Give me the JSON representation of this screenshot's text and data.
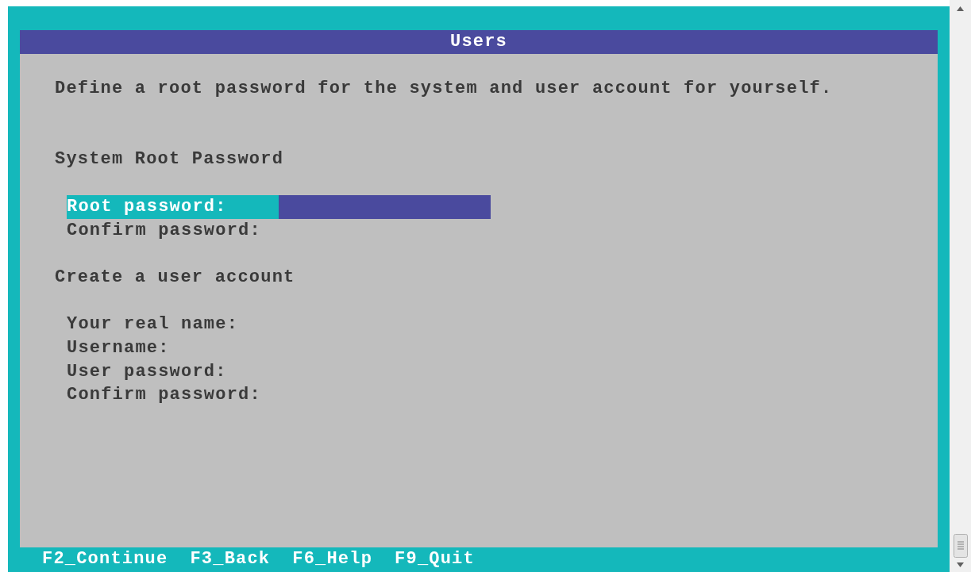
{
  "dialog": {
    "title": "Users",
    "description": "Define a root password for the system and user account for yourself.",
    "sections": [
      {
        "heading": "System Root Password",
        "fields": [
          {
            "label": "Root password:",
            "focused": true
          },
          {
            "label": "Confirm password:",
            "focused": false
          }
        ]
      },
      {
        "heading": "Create a user account",
        "fields": [
          {
            "label": "Your real name:",
            "focused": false
          },
          {
            "label": "Username:",
            "focused": false
          },
          {
            "label": "User password:",
            "focused": false
          },
          {
            "label": "Confirm password:",
            "focused": false
          }
        ]
      }
    ]
  },
  "function_keys": [
    "F2_Continue",
    "F3_Back",
    "F6_Help",
    "F9_Quit"
  ]
}
